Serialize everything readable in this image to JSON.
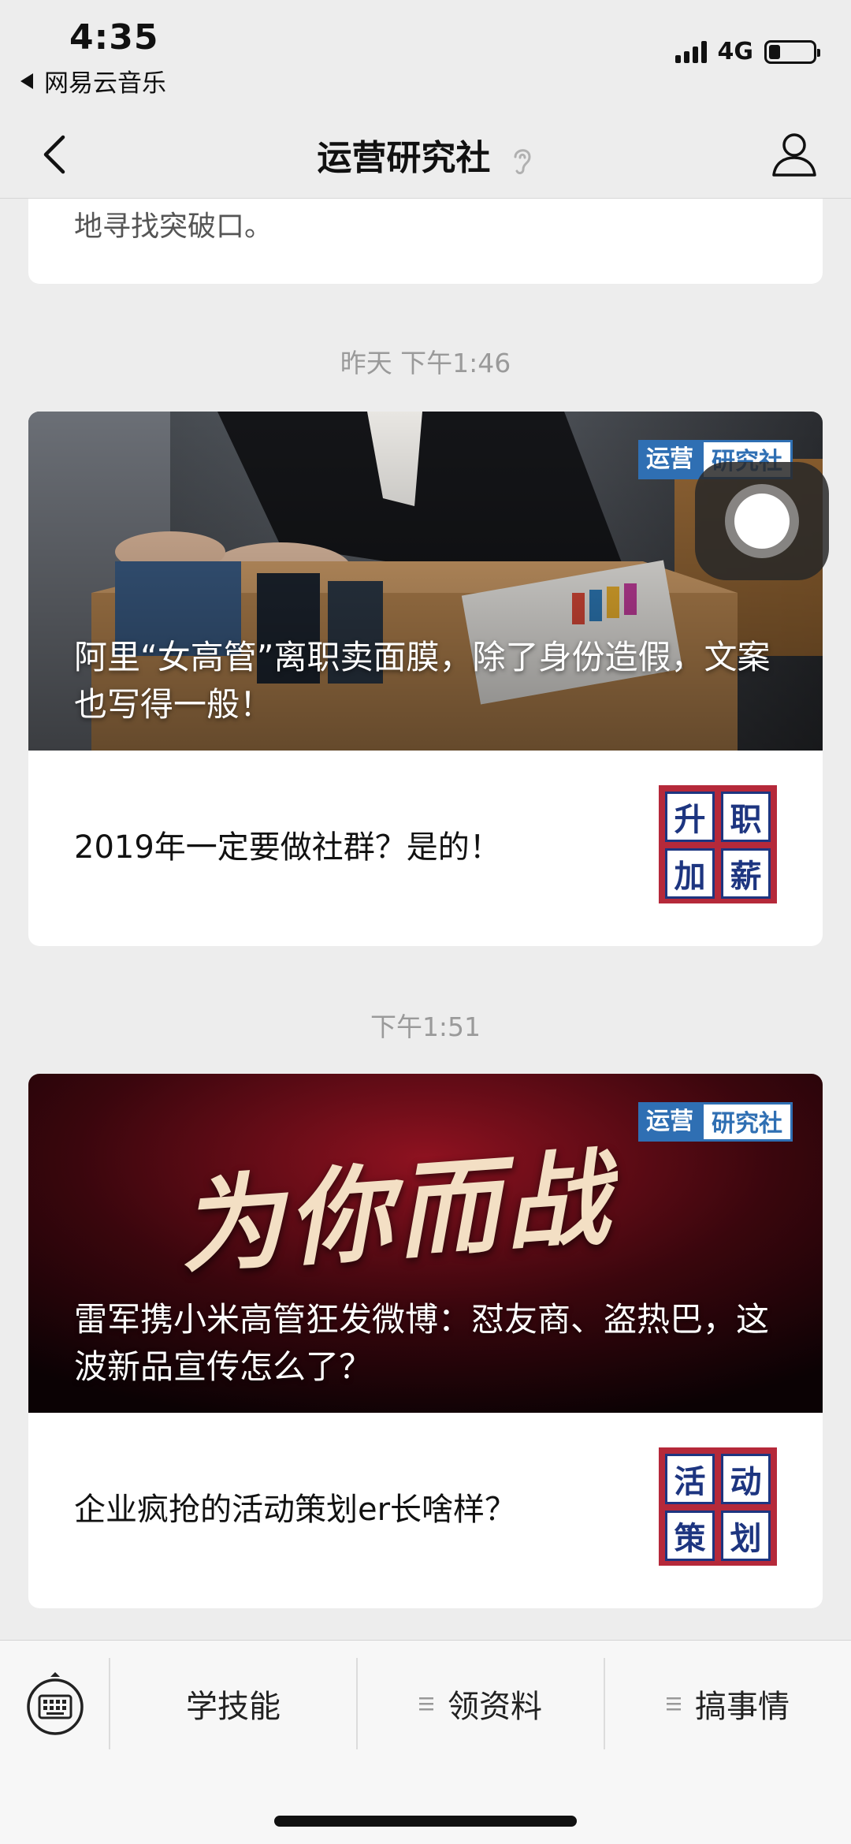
{
  "status_bar": {
    "time": "4:35",
    "back_app": "网易云音乐",
    "network": "4G"
  },
  "nav": {
    "title": "运营研究社"
  },
  "top_card": {
    "text": "地寻找突破口。"
  },
  "groups": [
    {
      "timestamp": "昨天 下午1:46",
      "cover_title": "阿里“女高管”离职卖面膜，除了身份造假，文案也写得一般！",
      "brand_left": "运营",
      "brand_right": "研究社",
      "item_text": "2019年一定要做社群？是的！",
      "thumb": [
        "升",
        "职",
        "加",
        "薪"
      ]
    },
    {
      "timestamp": "下午1:51",
      "cover_art_text": "为你而战",
      "cover_title": "雷军携小米高管狂发微博：怼友商、盗热巴，这波新品宣传怎么了？",
      "brand_left": "运营",
      "brand_right": "研究社",
      "item_text": "企业疯抢的活动策划er长啥样？",
      "thumb": [
        "活",
        "动",
        "策",
        "划"
      ]
    }
  ],
  "bottom_menu": {
    "items": [
      "学技能",
      "领资料",
      "搞事情"
    ]
  },
  "colors": {
    "background": "#ededed",
    "brand_blue": "#2f6fb3",
    "thumb_red": "#b5293a",
    "thumb_navy": "#1d3580"
  }
}
